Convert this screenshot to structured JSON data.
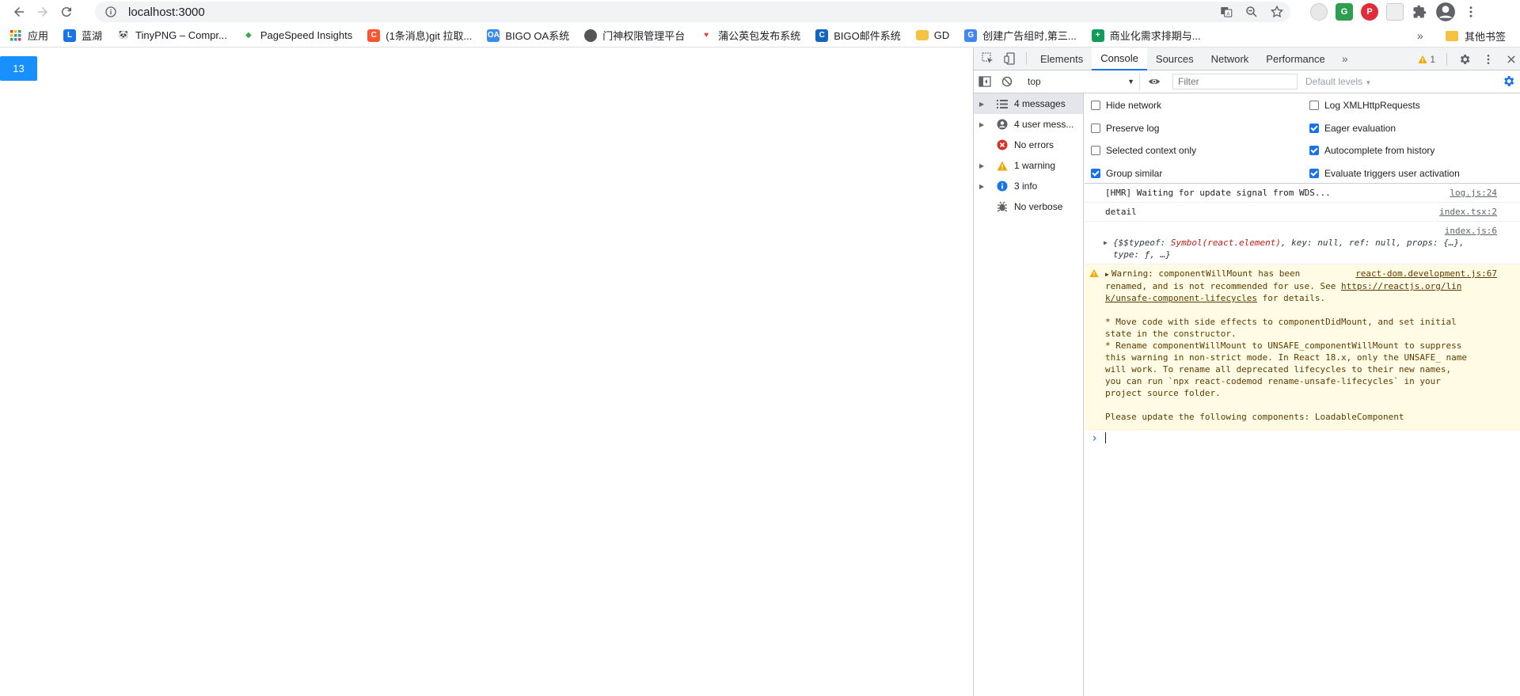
{
  "browser": {
    "url": "localhost:3000",
    "bookmarks": [
      {
        "label": "应用",
        "icon": "apps-grid-icon",
        "color": "#4285f4"
      },
      {
        "label": "蓝湖",
        "icon": "lanhu-icon",
        "color": "#1a73e8"
      },
      {
        "label": "TinyPNG – Compr...",
        "icon": "panda-icon",
        "color": "#333333"
      },
      {
        "label": "PageSpeed Insights",
        "icon": "pagespeed-icon",
        "color": "#34a853"
      },
      {
        "label": "(1条消息)git 拉取...",
        "icon": "csdn-icon",
        "color": "#fc5531"
      },
      {
        "label": "BIGO OA系统",
        "icon": "oa-icon",
        "color": "#3b8beb"
      },
      {
        "label": "门神权限管理平台",
        "icon": "globe-icon",
        "color": "#555555"
      },
      {
        "label": "蒲公英包发布系统",
        "icon": "pgyer-icon",
        "color": "#e0453b"
      },
      {
        "label": "BIGO邮件系统",
        "icon": "mail-icon",
        "color": "#1565c0"
      },
      {
        "label": "GD",
        "icon": "folder-icon",
        "color": "#f5c242"
      },
      {
        "label": "创建广告组时,第三...",
        "icon": "google-ads-icon",
        "color": "#4285f4"
      },
      {
        "label": "商业化需求排期与...",
        "icon": "sheets-icon",
        "color": "#0f9d58"
      }
    ],
    "bookmarks_more": "»",
    "other_bookmarks": "其他书签"
  },
  "page": {
    "counter_label": "13"
  },
  "devtools": {
    "tabs": [
      "Elements",
      "Console",
      "Sources",
      "Network",
      "Performance"
    ],
    "active_tab": "Console",
    "more_tabs": "»",
    "warning_count": "1",
    "context": "top",
    "filter_placeholder": "Filter",
    "levels": "Default levels",
    "sidebar": [
      {
        "label": "4 messages",
        "icon": "list-icon",
        "expandable": true
      },
      {
        "label": "4 user mess...",
        "icon": "user-icon",
        "expandable": true
      },
      {
        "label": "No errors",
        "icon": "error-icon",
        "expandable": false
      },
      {
        "label": "1 warning",
        "icon": "warning-icon",
        "expandable": true
      },
      {
        "label": "3 info",
        "icon": "info-icon",
        "expandable": true
      },
      {
        "label": "No verbose",
        "icon": "bug-icon",
        "expandable": false
      }
    ],
    "settings": {
      "hide_network": {
        "label": "Hide network",
        "checked": false
      },
      "preserve_log": {
        "label": "Preserve log",
        "checked": false
      },
      "selected_context": {
        "label": "Selected context only",
        "checked": false
      },
      "group_similar": {
        "label": "Group similar",
        "checked": true
      },
      "log_xhr": {
        "label": "Log XMLHttpRequests",
        "checked": false
      },
      "eager_eval": {
        "label": "Eager evaluation",
        "checked": true
      },
      "autocomplete": {
        "label": "Autocomplete from history",
        "checked": true
      },
      "evaluate_triggers": {
        "label": "Evaluate triggers user activation",
        "checked": true
      }
    },
    "messages": {
      "hmr": {
        "text": "[HMR] Waiting for update signal from WDS...",
        "source": "log.js:24"
      },
      "detail": {
        "text": "detail",
        "source": "index.tsx:2"
      },
      "object": {
        "source": "index.js:6",
        "line1_open": "{$$typeof: ",
        "line1_symbol": "Symbol(react.element)",
        "line1_rest": ", key: null, ref: null, props: {…},",
        "line2": "type: ƒ, …}"
      },
      "warning": {
        "source": "react-dom.development.js:67",
        "line1": "Warning: componentWillMount has been",
        "line2_text": "renamed, and is not recommended for use. See ",
        "link_part1": "https://reactjs.org/lin",
        "link_part2": "k/unsafe-component-lifecycles",
        "line3_rest": " for details.",
        "para2": "* Move code with side effects to componentDidMount, and set initial\nstate in the constructor.\n* Rename componentWillMount to UNSAFE_componentWillMount to suppress\nthis warning in non-strict mode. In React 18.x, only the UNSAFE_ name\nwill work. To rename all deprecated lifecycles to their new names,\nyou can run `npx react-codemod rename-unsafe-lifecycles` in your\nproject source folder.",
        "para3": "Please update the following components: LoadableComponent"
      }
    },
    "prompt_symbol": "›"
  }
}
